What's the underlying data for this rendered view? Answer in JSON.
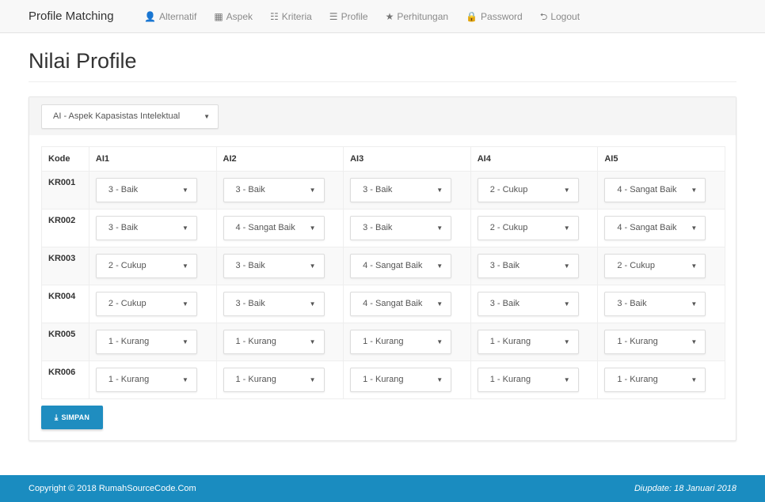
{
  "navbar": {
    "brand": "Profile Matching",
    "items": [
      {
        "label": "Alternatif",
        "icon": "user-icon",
        "glyph": "👤"
      },
      {
        "label": "Aspek",
        "icon": "grid-icon",
        "glyph": "▦"
      },
      {
        "label": "Kriteria",
        "icon": "grid-small-icon",
        "glyph": "☷"
      },
      {
        "label": "Profile",
        "icon": "list-icon",
        "glyph": "☰"
      },
      {
        "label": "Perhitungan",
        "icon": "star-icon",
        "glyph": "★"
      },
      {
        "label": "Password",
        "icon": "lock-icon",
        "glyph": "🔒"
      },
      {
        "label": "Logout",
        "icon": "logout-icon",
        "glyph": "⮌"
      }
    ]
  },
  "page": {
    "title": "Nilai Profile"
  },
  "filter": {
    "selected": "AI - Aspek Kapasistas Intelektual"
  },
  "table": {
    "headers": [
      "Kode",
      "AI1",
      "AI2",
      "AI3",
      "AI4",
      "AI5"
    ],
    "rows": [
      {
        "kode": "KR001",
        "values": [
          "3 - Baik",
          "3 - Baik",
          "3 - Baik",
          "2 - Cukup",
          "4 - Sangat Baik"
        ]
      },
      {
        "kode": "KR002",
        "values": [
          "3 - Baik",
          "4 - Sangat Baik",
          "3 - Baik",
          "2 - Cukup",
          "4 - Sangat Baik"
        ]
      },
      {
        "kode": "KR003",
        "values": [
          "2 - Cukup",
          "3 - Baik",
          "4 - Sangat Baik",
          "3 - Baik",
          "2 - Cukup"
        ]
      },
      {
        "kode": "KR004",
        "values": [
          "2 - Cukup",
          "3 - Baik",
          "4 - Sangat Baik",
          "3 - Baik",
          "3 - Baik"
        ]
      },
      {
        "kode": "KR005",
        "values": [
          "1 - Kurang",
          "1 - Kurang",
          "1 - Kurang",
          "1 - Kurang",
          "1 - Kurang"
        ]
      },
      {
        "kode": "KR006",
        "values": [
          "1 - Kurang",
          "1 - Kurang",
          "1 - Kurang",
          "1 - Kurang",
          "1 - Kurang"
        ]
      }
    ]
  },
  "actions": {
    "save_label": "SIMPAN",
    "save_icon": "download-icon",
    "save_glyph": "⤓"
  },
  "footer": {
    "copyright": "Copyright © 2018 RumahSourceCode.Com",
    "updated": "Diupdate: 18 Januari 2018"
  },
  "colors": {
    "accent": "#1f8dc0",
    "footer": "#1a8cc0",
    "navbar": "#f8f8f8"
  }
}
